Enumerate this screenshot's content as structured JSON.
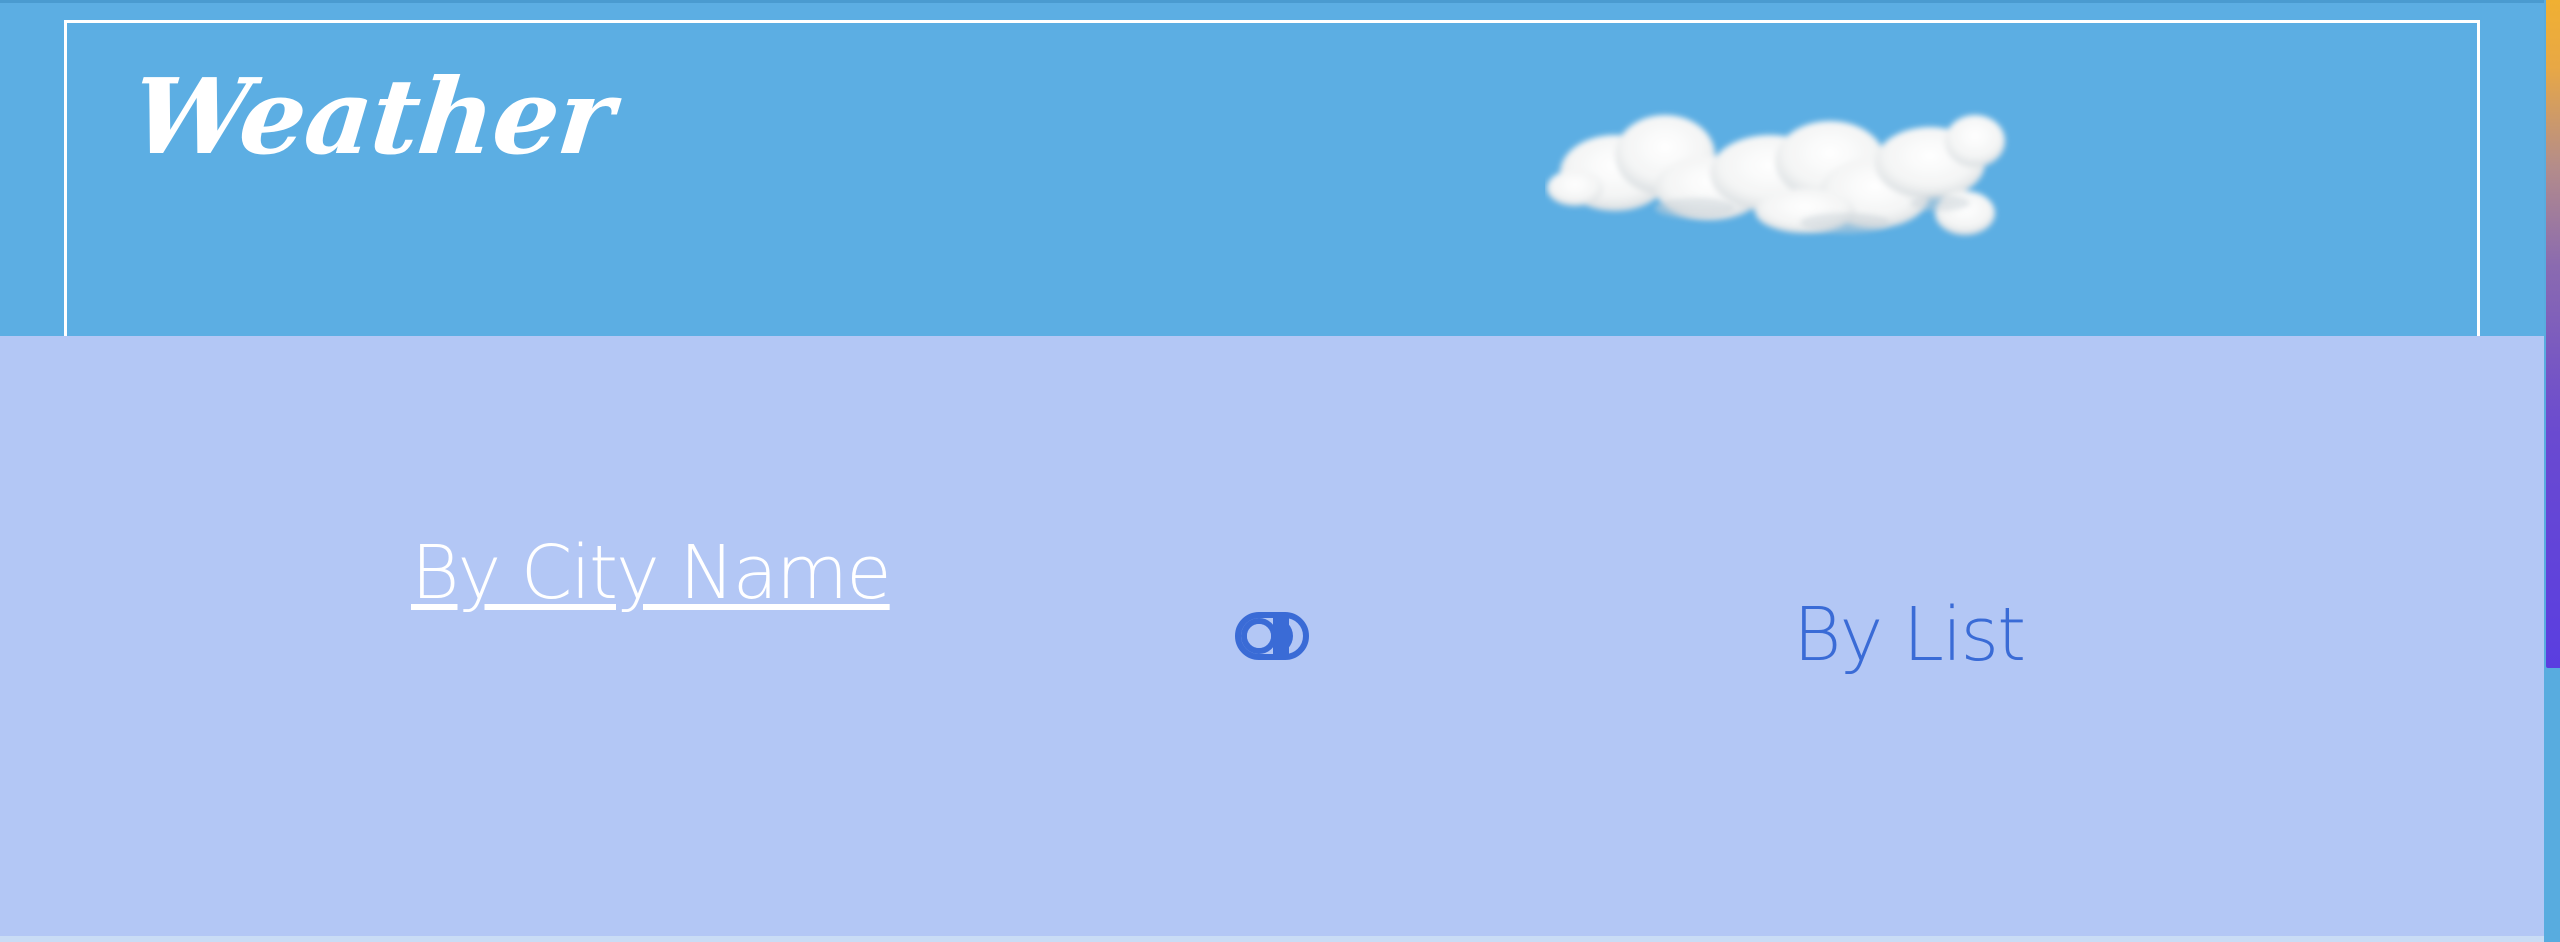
{
  "header": {
    "title": "Weather",
    "background_color": "#5caee3",
    "decoration_icon": "cloud-image"
  },
  "search_modes": {
    "city_label": "By City Name",
    "list_label": "By List",
    "active": "city",
    "toggle_icon": "toggle-switch-icon",
    "active_color": "#ffffff",
    "inactive_color": "#3a6bd6",
    "panel_color": "#b3c7f5"
  }
}
